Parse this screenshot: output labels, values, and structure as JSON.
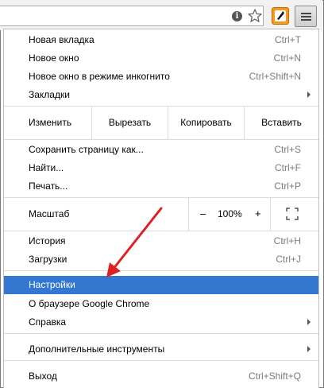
{
  "toolbar": {
    "icons": [
      "info-icon",
      "star-icon",
      "extension-icon",
      "hamburger-menu-icon"
    ],
    "info_glyph": "i"
  },
  "menu": {
    "items": [
      {
        "label": "Новая вкладка",
        "shortcut": "Ctrl+T"
      },
      {
        "label": "Новое окно",
        "shortcut": "Ctrl+N"
      },
      {
        "label": "Новое окно в режиме инкогнито",
        "shortcut": "Ctrl+Shift+N"
      },
      {
        "label": "Закладки",
        "submenu": true
      },
      {
        "label": "Сохранить страницу как...",
        "shortcut": "Ctrl+S"
      },
      {
        "label": "Найти...",
        "shortcut": "Ctrl+F"
      },
      {
        "label": "Печать...",
        "shortcut": "Ctrl+P"
      },
      {
        "label": "История",
        "shortcut": "Ctrl+H"
      },
      {
        "label": "Загрузки",
        "shortcut": "Ctrl+J"
      },
      {
        "label": "Настройки",
        "highlighted": true
      },
      {
        "label": "О браузере Google Chrome"
      },
      {
        "label": "Справка",
        "submenu": true
      },
      {
        "label": "Дополнительные инструменты",
        "submenu": true
      },
      {
        "label": "Выход",
        "shortcut": "Ctrl+Shift+Q"
      }
    ],
    "edit": {
      "label": "Изменить",
      "cut": "Вырезать",
      "copy": "Копировать",
      "paste": "Вставить"
    },
    "zoom": {
      "label": "Масштаб",
      "minus": "–",
      "value": "100%",
      "plus": "+"
    }
  },
  "colors": {
    "highlight": "#3477d1",
    "annotation_arrow": "#e02020",
    "shortcut_text": "#7b7b7b"
  }
}
